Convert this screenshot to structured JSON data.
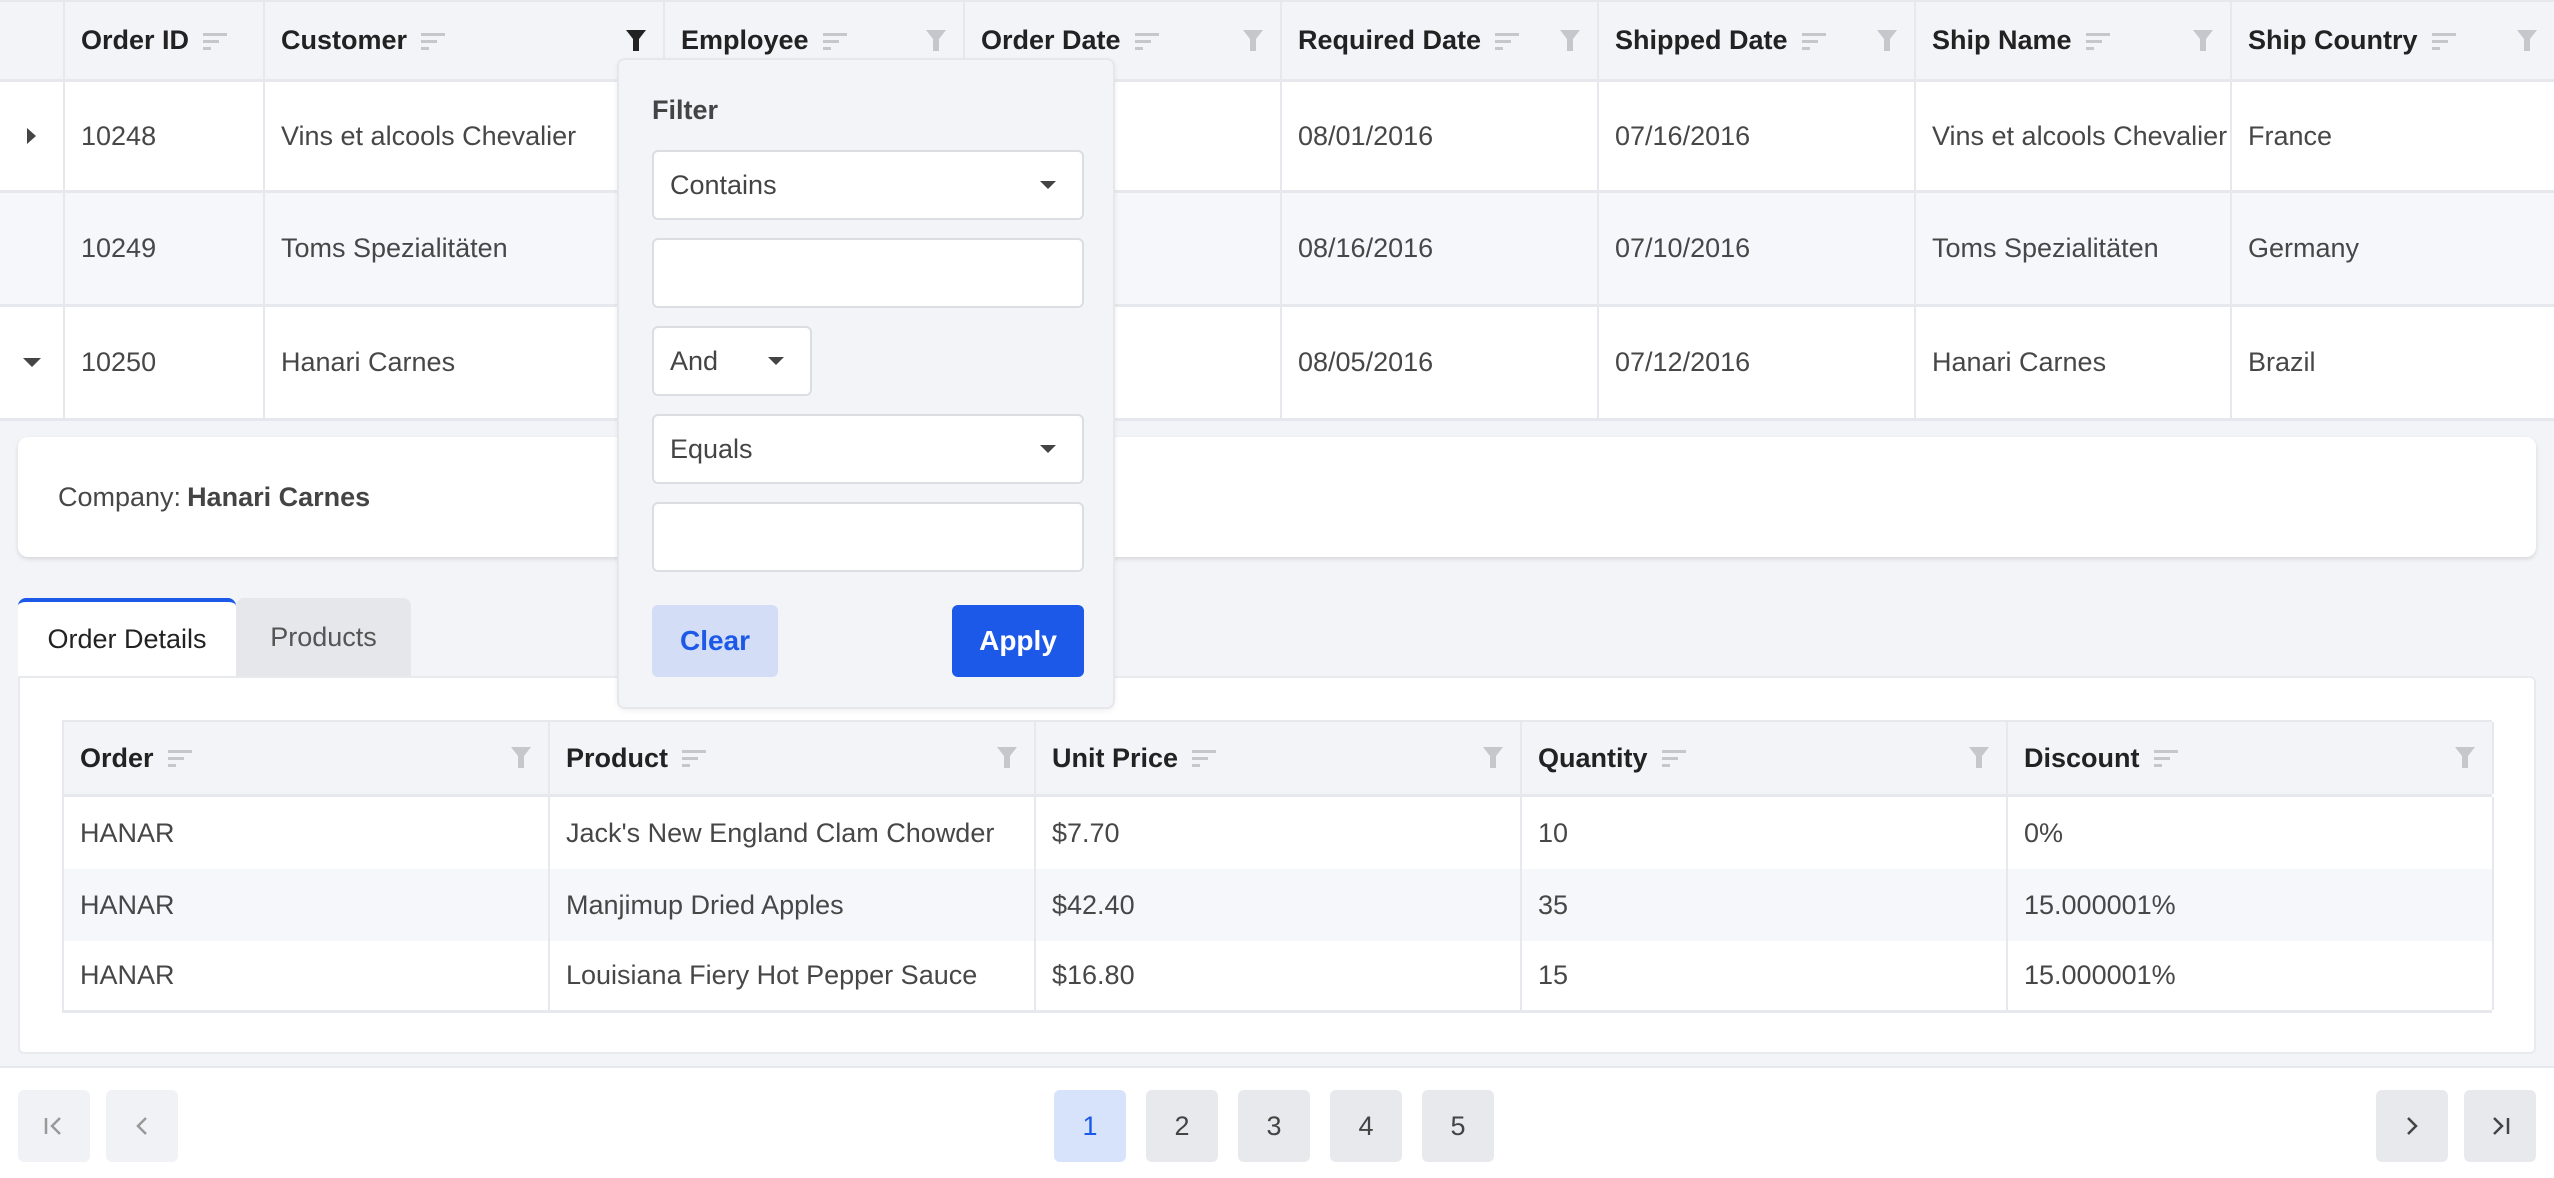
{
  "grid": {
    "columns": [
      {
        "label": ""
      },
      {
        "label": "Order ID"
      },
      {
        "label": "Customer"
      },
      {
        "label": "Employee"
      },
      {
        "label": "Order Date"
      },
      {
        "label": "Required Date"
      },
      {
        "label": "Shipped Date"
      },
      {
        "label": "Ship Name"
      },
      {
        "label": "Ship Country"
      }
    ],
    "active_filter_column": "Customer",
    "rows": [
      {
        "expander": "collapsed",
        "order_id": "10248",
        "customer": "Vins et alcools Chevalier",
        "employee": "",
        "order_date": "",
        "required_date": "08/01/2016",
        "shipped_date": "07/16/2016",
        "ship_name": "Vins et alcools Chevalier",
        "ship_country": "France"
      },
      {
        "expander": "none",
        "order_id": "10249",
        "customer": "Toms Spezialitäten",
        "employee": "",
        "order_date": "",
        "required_date": "08/16/2016",
        "shipped_date": "07/10/2016",
        "ship_name": "Toms Spezialitäten",
        "ship_country": "Germany"
      },
      {
        "expander": "expanded",
        "order_id": "10250",
        "customer": "Hanari Carnes",
        "employee": "",
        "order_date": "",
        "required_date": "08/05/2016",
        "shipped_date": "07/12/2016",
        "ship_name": "Hanari Carnes",
        "ship_country": "Brazil"
      }
    ]
  },
  "detail": {
    "company_label": "Company:",
    "company_value": "Hanari Carnes",
    "tabs": [
      {
        "label": "Order Details",
        "active": true
      },
      {
        "label": "Products",
        "active": false
      }
    ],
    "table": {
      "columns": [
        "Order",
        "Product",
        "Unit Price",
        "Quantity",
        "Discount"
      ],
      "rows": [
        [
          "HANAR",
          "Jack's New England Clam Chowder",
          "$7.70",
          "10",
          "0%"
        ],
        [
          "HANAR",
          "Manjimup Dried Apples",
          "$42.40",
          "35",
          "15.000001%"
        ],
        [
          "HANAR",
          "Louisiana Fiery Hot Pepper Sauce",
          "$16.80",
          "15",
          "15.000001%"
        ]
      ]
    }
  },
  "filter_popup": {
    "title": "Filter",
    "operator1": "Contains",
    "value1": "",
    "logic": "And",
    "operator2": "Equals",
    "value2": "",
    "clear_label": "Clear",
    "apply_label": "Apply"
  },
  "pager": {
    "pages": [
      "1",
      "2",
      "3",
      "4",
      "5"
    ],
    "current_page": "1",
    "first_icon": "first-page-icon",
    "prev_icon": "previous-page-icon",
    "next_icon": "next-page-icon",
    "last_icon": "last-page-icon"
  },
  "colors": {
    "accent": "#1c59e8",
    "header_bg": "#f3f4f8",
    "alt_row": "#f6f7fa",
    "border": "#e7e8ed"
  }
}
